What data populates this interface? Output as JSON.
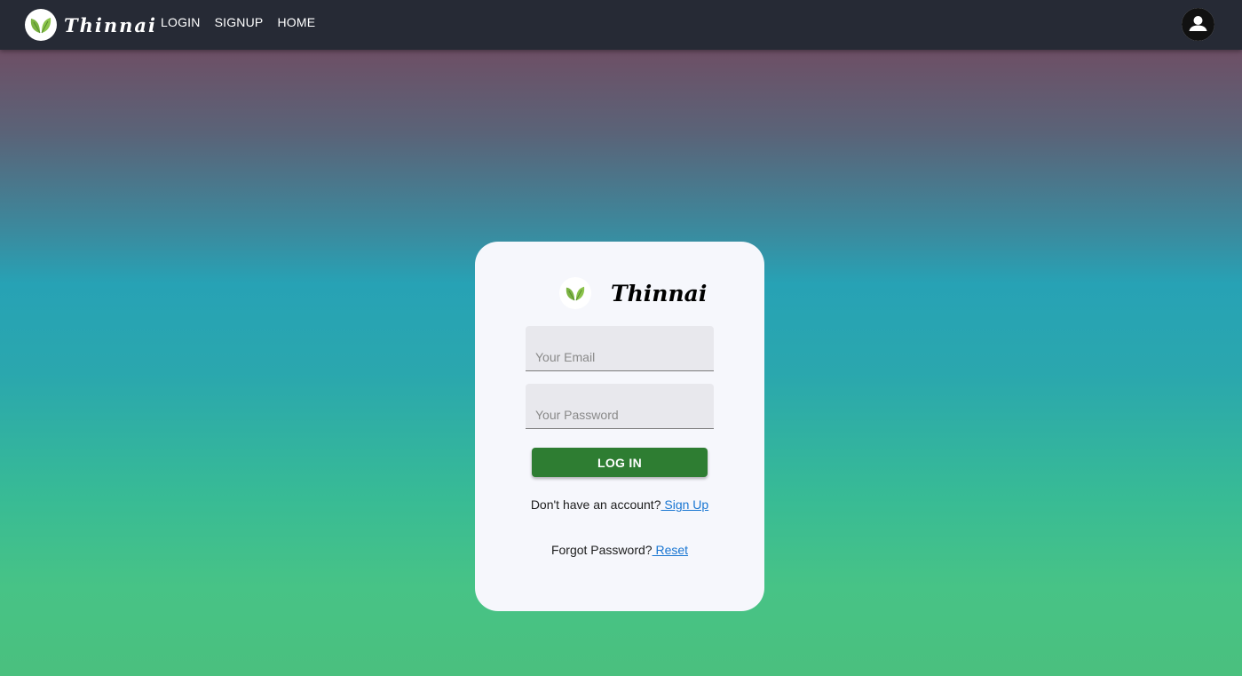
{
  "navbar": {
    "brand": "Thinnai",
    "links": [
      "LOGIN",
      "SIGNUP",
      "HOME"
    ]
  },
  "card": {
    "title": "Thinnai",
    "email_placeholder": "Your Email",
    "password_placeholder": "Your Password",
    "login_label": "LOG IN",
    "signup_prompt": "Don't have an account?",
    "signup_link": " Sign Up",
    "forgot_prompt": "Forgot Password?",
    "reset_link": " Reset"
  },
  "icons": {
    "logo": "leaf-logo-icon",
    "account": "account-circle-icon"
  },
  "colors": {
    "navbar": "#262a35",
    "button": "#2e7d32",
    "link": "#1976d2",
    "leaf": "#7cb342"
  }
}
